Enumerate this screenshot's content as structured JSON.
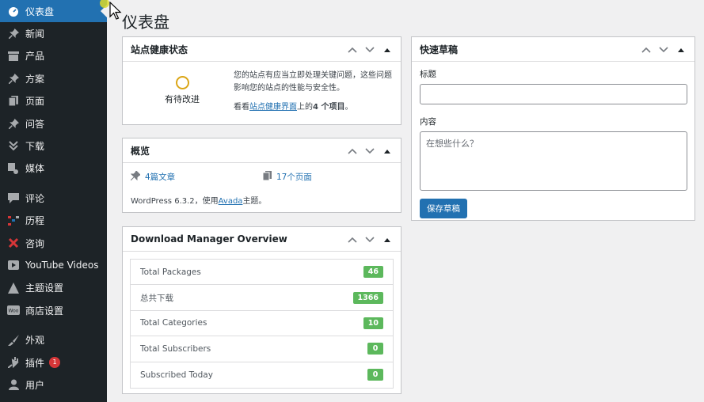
{
  "sidebar": {
    "items": [
      {
        "label": "仪表盘",
        "icon": "dashboard-icon",
        "active": true
      },
      {
        "label": "新闻",
        "icon": "pin-icon"
      },
      {
        "label": "产品",
        "icon": "archive-icon"
      },
      {
        "label": "方案",
        "icon": "pin-icon"
      },
      {
        "label": "页面",
        "icon": "page-icon"
      },
      {
        "label": "问答",
        "icon": "pin-icon"
      },
      {
        "label": "下载",
        "icon": "download-icon"
      },
      {
        "label": "媒体",
        "icon": "media-icon"
      },
      {
        "label": "评论",
        "icon": "comment-icon"
      },
      {
        "label": "历程",
        "icon": "timeline-icon"
      },
      {
        "label": "咨询",
        "icon": "form-icon"
      },
      {
        "label": "YouTube Videos",
        "icon": "video-icon"
      },
      {
        "label": "主题设置",
        "icon": "theme-icon"
      },
      {
        "label": "商店设置",
        "icon": "woo-icon"
      },
      {
        "label": "外观",
        "icon": "brush-icon"
      },
      {
        "label": "插件",
        "icon": "plugin-icon",
        "badge": "1"
      },
      {
        "label": "用户",
        "icon": "user-icon"
      }
    ]
  },
  "page_title": "仪表盘",
  "site_health": {
    "title": "站点健康状态",
    "status": "有待改进",
    "description": "您的站点有应当立即处理关键问题，这些问题影响您的站点的性能与安全性。",
    "link_prefix": "看看",
    "link_text": "站点健康界面",
    "link_suffix_1": "上的",
    "count_text": "4 个项目",
    "link_suffix_2": "。"
  },
  "overview": {
    "title": "概览",
    "posts": "4篇文章",
    "pages": "17个页面",
    "wp_prefix": "WordPress 6.3.2，使用",
    "theme_link": "Avada",
    "wp_suffix": "主题。"
  },
  "dm_overview": {
    "title": "Download Manager Overview",
    "rows": [
      {
        "label": "Total Packages",
        "value": "46"
      },
      {
        "label": "总共下载",
        "value": "1366"
      },
      {
        "label": "Total Categories",
        "value": "10"
      },
      {
        "label": "Total Subscribers",
        "value": "0"
      },
      {
        "label": "Subscribed Today",
        "value": "0"
      }
    ]
  },
  "quick_draft": {
    "title": "快速草稿",
    "title_label": "标题",
    "title_value": "",
    "content_label": "内容",
    "content_placeholder": "在想些什么？",
    "save_button": "保存草稿"
  },
  "colors": {
    "sidebar_bg": "#1d2327",
    "accent": "#2271b1",
    "badge_green": "#5cb85c",
    "warning": "#dba617"
  }
}
